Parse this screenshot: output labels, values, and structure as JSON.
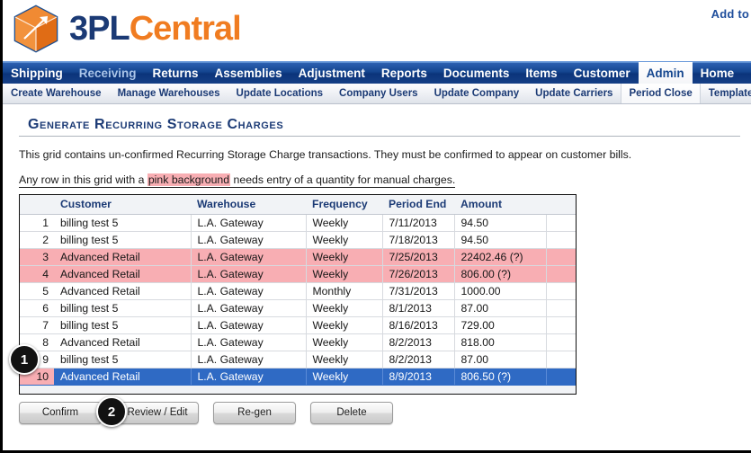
{
  "header": {
    "logo_primary": "3PL",
    "logo_secondary": "Central",
    "logo_icon": "orange-cube-logo",
    "add_to_link": "Add to"
  },
  "main_nav": {
    "items": [
      {
        "label": "Shipping",
        "state": "normal"
      },
      {
        "label": "Receiving",
        "state": "dim"
      },
      {
        "label": "Returns",
        "state": "normal"
      },
      {
        "label": "Assemblies",
        "state": "normal"
      },
      {
        "label": "Adjustment",
        "state": "normal"
      },
      {
        "label": "Reports",
        "state": "normal"
      },
      {
        "label": "Documents",
        "state": "normal"
      },
      {
        "label": "Items",
        "state": "normal"
      },
      {
        "label": "Customer",
        "state": "normal"
      },
      {
        "label": "Admin",
        "state": "active"
      },
      {
        "label": "Home",
        "state": "normal"
      }
    ]
  },
  "sub_nav": {
    "items": [
      {
        "label": "Create Warehouse",
        "state": "normal"
      },
      {
        "label": "Manage Warehouses",
        "state": "normal"
      },
      {
        "label": "Update Locations",
        "state": "normal"
      },
      {
        "label": "Company Users",
        "state": "normal"
      },
      {
        "label": "Update Company",
        "state": "normal"
      },
      {
        "label": "Update Carriers",
        "state": "normal"
      },
      {
        "label": "Period Close",
        "state": "active"
      },
      {
        "label": "Templates",
        "state": "normal"
      }
    ]
  },
  "page": {
    "title": "Generate Recurring Storage Charges",
    "paragraph_1": "This grid contains un-confirmed Recurring Storage Charge transactions. They must be confirmed to appear on customer bills.",
    "paragraph_2_before": "Any row in this grid with a ",
    "paragraph_2_highlight": "pink background",
    "paragraph_2_after": " needs entry of a quantity for manual charges."
  },
  "grid": {
    "columns": [
      "",
      "Customer",
      "Warehouse",
      "Frequency",
      "Period End",
      "Amount",
      ""
    ],
    "rows": [
      {
        "num": "1",
        "customer": "billing test 5",
        "warehouse": "L.A. Gateway",
        "frequency": "Weekly",
        "period_end": "7/11/2013",
        "amount": "94.50",
        "state": "normal"
      },
      {
        "num": "2",
        "customer": "billing test 5",
        "warehouse": "L.A. Gateway",
        "frequency": "Weekly",
        "period_end": "7/18/2013",
        "amount": "94.50",
        "state": "normal"
      },
      {
        "num": "3",
        "customer": "Advanced Retail",
        "warehouse": "L.A. Gateway",
        "frequency": "Weekly",
        "period_end": "7/25/2013",
        "amount": "22402.46 (?)",
        "state": "pink"
      },
      {
        "num": "4",
        "customer": "Advanced Retail",
        "warehouse": "L.A. Gateway",
        "frequency": "Weekly",
        "period_end": "7/26/2013",
        "amount": "806.00 (?)",
        "state": "pink"
      },
      {
        "num": "5",
        "customer": "Advanced Retail",
        "warehouse": "L.A. Gateway",
        "frequency": "Monthly",
        "period_end": "7/31/2013",
        "amount": "1000.00",
        "state": "normal"
      },
      {
        "num": "6",
        "customer": "billing test 5",
        "warehouse": "L.A. Gateway",
        "frequency": "Weekly",
        "period_end": "8/1/2013",
        "amount": "87.00",
        "state": "normal"
      },
      {
        "num": "7",
        "customer": "billing test 5",
        "warehouse": "L.A. Gateway",
        "frequency": "Weekly",
        "period_end": "8/16/2013",
        "amount": "729.00",
        "state": "normal"
      },
      {
        "num": "8",
        "customer": "Advanced Retail",
        "warehouse": "L.A. Gateway",
        "frequency": "Weekly",
        "period_end": "8/2/2013",
        "amount": "818.00",
        "state": "normal"
      },
      {
        "num": "9",
        "customer": "billing test 5",
        "warehouse": "L.A. Gateway",
        "frequency": "Weekly",
        "period_end": "8/2/2013",
        "amount": "87.00",
        "state": "normal"
      },
      {
        "num": "10",
        "customer": "Advanced Retail",
        "warehouse": "L.A. Gateway",
        "frequency": "Weekly",
        "period_end": "8/9/2013",
        "amount": "806.50 (?)",
        "state": "selected"
      }
    ]
  },
  "buttons": [
    {
      "label": "Confirm"
    },
    {
      "label": "Review / Edit"
    },
    {
      "label": "Re-gen"
    },
    {
      "label": "Delete"
    }
  ],
  "callouts": [
    {
      "label": "1"
    },
    {
      "label": "2"
    }
  ],
  "colors": {
    "nav_blue": "#14458f",
    "brand_orange": "#f07c21",
    "brand_navy": "#1b3a75",
    "row_pink": "#f8aeb3",
    "row_selected": "#2f6ac4",
    "grid_background": "#f1f3f6"
  }
}
